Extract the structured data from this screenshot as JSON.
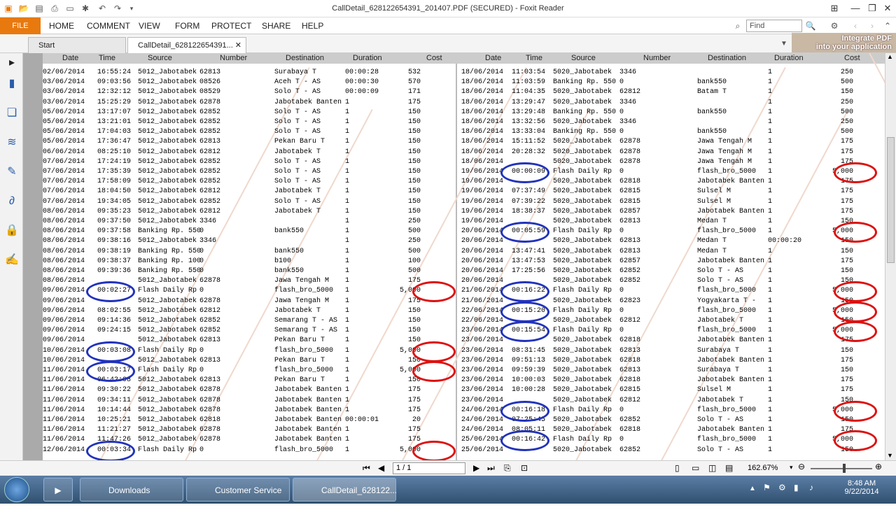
{
  "window": {
    "title": "CallDetail_628122654391_201407.PDF (SECURED) - Foxit Reader"
  },
  "ribbon": {
    "file": "FILE",
    "menus": [
      "HOME",
      "COMMENT",
      "VIEW",
      "FORM",
      "PROTECT",
      "SHARE",
      "HELP"
    ],
    "find_placeholder": "Find",
    "promo": [
      "Integrate PDF",
      "into your application"
    ]
  },
  "tabs": [
    "Start",
    "CallDetail_628122654391..."
  ],
  "table": {
    "headers": [
      "Date",
      "Time",
      "Source",
      "Number",
      "Destination",
      "Duration",
      "Cost"
    ],
    "left_rows": [
      [
        "02/06/2014",
        "16:55:24",
        "5012_Jabotabek",
        "62813",
        "Surabaya T",
        "00:00:28",
        "532"
      ],
      [
        "03/06/2014",
        "09:03:56",
        "5012_Jabotabek",
        "08526",
        "Aceh T - AS",
        "00:00:30",
        "570"
      ],
      [
        "03/06/2014",
        "12:32:12",
        "5012_Jabotabek",
        "08529",
        "Solo T - AS",
        "00:00:09",
        "171"
      ],
      [
        "03/06/2014",
        "15:25:29",
        "5012_Jabotabek",
        "62878",
        "Jabotabek Banten",
        "1",
        "175"
      ],
      [
        "05/06/2014",
        "13:17:07",
        "5012_Jabotabek",
        "62852",
        "Solo T - AS",
        "1",
        "150"
      ],
      [
        "05/06/2014",
        "13:21:01",
        "5012_Jabotabek",
        "62852",
        "Solo T - AS",
        "1",
        "150"
      ],
      [
        "05/06/2014",
        "17:04:03",
        "5012_Jabotabek",
        "62852",
        "Solo T - AS",
        "1",
        "150"
      ],
      [
        "05/06/2014",
        "17:36:47",
        "5012_Jabotabek",
        "62813",
        "Pekan Baru T",
        "1",
        "150"
      ],
      [
        "06/06/2014",
        "08:25:10",
        "5012_Jabotabek",
        "62812",
        "Jabotabek T",
        "1",
        "150"
      ],
      [
        "07/06/2014",
        "17:24:19",
        "5012_Jabotabek",
        "62852",
        "Solo T - AS",
        "1",
        "150"
      ],
      [
        "07/06/2014",
        "17:35:39",
        "5012_Jabotabek",
        "62852",
        "Solo T - AS",
        "1",
        "150"
      ],
      [
        "07/06/2014",
        "17:58:09",
        "5012_Jabotabek",
        "62852",
        "Solo T - AS",
        "1",
        "150"
      ],
      [
        "07/06/2014",
        "18:04:50",
        "5012_Jabotabek",
        "62812",
        "Jabotabek T",
        "1",
        "150"
      ],
      [
        "07/06/2014",
        "19:34:05",
        "5012_Jabotabek",
        "62852",
        "Solo T - AS",
        "1",
        "150"
      ],
      [
        "08/06/2014",
        "09:35:23",
        "5012_Jabotabek",
        "62812",
        "Jabotabek T",
        "1",
        "150"
      ],
      [
        "08/06/2014",
        "09:37:50",
        "5012_Jabotabek",
        "3346",
        "",
        "1",
        "250"
      ],
      [
        "08/06/2014",
        "09:37:58",
        "Banking Rp. 550",
        "0",
        "bank550",
        "1",
        "500"
      ],
      [
        "08/06/2014",
        "09:38:16",
        "5012_Jabotabek",
        "3346",
        "",
        "1",
        "250"
      ],
      [
        "08/06/2014",
        "09:38:19",
        "Banking Rp. 550",
        "0",
        "bank550",
        "1",
        "500"
      ],
      [
        "08/06/2014",
        "09:38:37",
        "Banking Rp. 100",
        "0",
        "b100",
        "1",
        "100"
      ],
      [
        "08/06/2014",
        "09:39:36",
        "Banking Rp. 550",
        "0",
        "bank550",
        "1",
        "500"
      ],
      [
        "08/06/2014",
        "",
        "5012_Jabotabek",
        "62878",
        "Jawa Tengah M",
        "1",
        "175"
      ],
      [
        "09/06/2014",
        "00:02:27",
        "Flash Daily Rp",
        "0",
        "flash_bro_5000",
        "1",
        "5,000"
      ],
      [
        "09/06/2014",
        "",
        "5012_Jabotabek",
        "62878",
        "Jawa Tengah M",
        "1",
        "175"
      ],
      [
        "09/06/2014",
        "08:02:55",
        "5012_Jabotabek",
        "62812",
        "Jabotabek T",
        "1",
        "150"
      ],
      [
        "09/06/2014",
        "09:14:36",
        "5012_Jabotabek",
        "62852",
        "Semarang T - AS",
        "1",
        "150"
      ],
      [
        "09/06/2014",
        "09:24:15",
        "5012_Jabotabek",
        "62852",
        "Semarang T - AS",
        "1",
        "150"
      ],
      [
        "09/06/2014",
        "",
        "5012_Jabotabek",
        "62813",
        "Pekan Baru T",
        "1",
        "150"
      ],
      [
        "10/06/2014",
        "00:03:08",
        "Flash Daily Rp",
        "0",
        "flash_bro_5000",
        "1",
        "5,000"
      ],
      [
        "10/06/2014",
        "",
        "5012_Jabotabek",
        "62813",
        "Pekan Baru T",
        "1",
        "150"
      ],
      [
        "11/06/2014",
        "00:03:17",
        "Flash Daily Rp",
        "0",
        "flash_bro_5000",
        "1",
        "5,000"
      ],
      [
        "11/06/2014",
        "06:42:08",
        "5012_Jabotabek",
        "62813",
        "Pekan Baru T",
        "1",
        "150"
      ],
      [
        "11/06/2014",
        "09:30:22",
        "5012_Jabotabek",
        "62878",
        "Jabotabek Banten",
        "1",
        "175"
      ],
      [
        "11/06/2014",
        "09:34:11",
        "5012_Jabotabek",
        "62878",
        "Jabotabek Banten",
        "1",
        "175"
      ],
      [
        "11/06/2014",
        "10:14:44",
        "5012_Jabotabek",
        "62878",
        "Jabotabek Banten",
        "1",
        "175"
      ],
      [
        "11/06/2014",
        "10:25:21",
        "5012_Jabotabek",
        "62818",
        "Jabotabek Banten",
        "00:00:01",
        "20"
      ],
      [
        "11/06/2014",
        "11:21:27",
        "5012_Jabotabek",
        "62878",
        "Jabotabek Banten",
        "1",
        "175"
      ],
      [
        "11/06/2014",
        "11:47:26",
        "5012_Jabotabek",
        "62878",
        "Jabotabek Banten",
        "1",
        "175"
      ],
      [
        "12/06/2014",
        "00:03:34",
        "Flash Daily Rp",
        "0",
        "flash_bro_5000",
        "1",
        "5,000"
      ]
    ],
    "right_rows": [
      [
        "18/06/2014",
        "11:03:54",
        "5020_Jabotabek",
        "3346",
        "",
        "1",
        "250"
      ],
      [
        "18/06/2014",
        "11:03:59",
        "Banking Rp. 550",
        "0",
        "bank550",
        "1",
        "500"
      ],
      [
        "18/06/2014",
        "11:04:35",
        "5020_Jabotabek",
        "62812",
        "Batam T",
        "1",
        "150"
      ],
      [
        "18/06/2014",
        "13:29:47",
        "5020_Jabotabek",
        "3346",
        "",
        "1",
        "250"
      ],
      [
        "18/06/2014",
        "13:29:48",
        "Banking Rp. 550",
        "0",
        "bank550",
        "1",
        "500"
      ],
      [
        "18/06/2014",
        "13:32:56",
        "5020_Jabotabek",
        "3346",
        "",
        "1",
        "250"
      ],
      [
        "18/06/2014",
        "13:33:04",
        "Banking Rp. 550",
        "0",
        "bank550",
        "1",
        "500"
      ],
      [
        "18/06/2014",
        "15:11:52",
        "5020_Jabotabek",
        "62878",
        "Jawa Tengah M",
        "1",
        "175"
      ],
      [
        "18/06/2014",
        "20:28:32",
        "5020_Jabotabek",
        "62878",
        "Jawa Tengah M",
        "1",
        "175"
      ],
      [
        "18/06/2014",
        "",
        "5020_Jabotabek",
        "62878",
        "Jawa Tengah M",
        "1",
        "175"
      ],
      [
        "19/06/2014",
        "00:00:09",
        "Flash Daily Rp",
        "0",
        "flash_bro_5000",
        "1",
        "5,000"
      ],
      [
        "19/06/2014",
        "",
        "5020_Jabotabek",
        "62818",
        "Jabotabek Banten",
        "1",
        "175"
      ],
      [
        "19/06/2014",
        "07:37:49",
        "5020_Jabotabek",
        "62815",
        "Sulsel M",
        "1",
        "175"
      ],
      [
        "19/06/2014",
        "07:39:22",
        "5020_Jabotabek",
        "62815",
        "Sulsel M",
        "1",
        "175"
      ],
      [
        "19/06/2014",
        "18:38:37",
        "5020_Jabotabek",
        "62857",
        "Jabotabek Banten",
        "1",
        "175"
      ],
      [
        "19/06/2014",
        "",
        "5020_Jabotabek",
        "62813",
        "Medan T",
        "1",
        "150"
      ],
      [
        "20/06/2014",
        "00:05:59",
        "Flash Daily Rp",
        "0",
        "flash_bro_5000",
        "1",
        "5,000"
      ],
      [
        "20/06/2014",
        "",
        "5020_Jabotabek",
        "62813",
        "Medan T",
        "00:00:20",
        "150"
      ],
      [
        "20/06/2014",
        "13:47:41",
        "5020_Jabotabek",
        "62813",
        "Medan T",
        "1",
        "150"
      ],
      [
        "20/06/2014",
        "13:47:53",
        "5020_Jabotabek",
        "62857",
        "Jabotabek Banten",
        "1",
        "175"
      ],
      [
        "20/06/2014",
        "17:25:56",
        "5020_Jabotabek",
        "62852",
        "Solo T - AS",
        "1",
        "150"
      ],
      [
        "20/06/2014",
        "",
        "5020_Jabotabek",
        "62852",
        "Solo T - AS",
        "1",
        "150"
      ],
      [
        "21/06/2014",
        "00:16:22",
        "Flash Daily Rp",
        "0",
        "flash_bro_5000",
        "1",
        "5,000"
      ],
      [
        "21/06/2014",
        "",
        "5020_Jabotabek",
        "62823",
        "Yogyakarta T -",
        "1",
        "150"
      ],
      [
        "22/06/2014",
        "00:15:20",
        "Flash Daily Rp",
        "0",
        "flash_bro_5000",
        "1",
        "5,000"
      ],
      [
        "22/06/2014",
        "",
        "5020_Jabotabek",
        "62812",
        "Jabotabek T",
        "1",
        "150"
      ],
      [
        "23/06/2014",
        "00:15:54",
        "Flash Daily Rp",
        "0",
        "flash_bro_5000",
        "1",
        "5,000"
      ],
      [
        "23/06/2014",
        "",
        "5020_Jabotabek",
        "62818",
        "Jabotabek Banten",
        "1",
        "175"
      ],
      [
        "23/06/2014",
        "08:31:45",
        "5020_Jabotabek",
        "62813",
        "Surabaya T",
        "1",
        "150"
      ],
      [
        "23/06/2014",
        "09:51:13",
        "5020_Jabotabek",
        "62818",
        "Jabotabek Banten",
        "1",
        "175"
      ],
      [
        "23/06/2014",
        "09:59:39",
        "5020_Jabotabek",
        "62813",
        "Surabaya T",
        "1",
        "150"
      ],
      [
        "23/06/2014",
        "10:00:03",
        "5020_Jabotabek",
        "62818",
        "Jabotabek Banten",
        "1",
        "175"
      ],
      [
        "23/06/2014",
        "10:00:28",
        "5020_Jabotabek",
        "62815",
        "Sulsel M",
        "1",
        "175"
      ],
      [
        "23/06/2014",
        "",
        "5020_Jabotabek",
        "62812",
        "Jabotabek T",
        "1",
        "150"
      ],
      [
        "24/06/2014",
        "00:16:18",
        "Flash Daily Rp",
        "0",
        "flash_bro_5000",
        "1",
        "5,000"
      ],
      [
        "24/06/2014",
        "07:25:45",
        "5020_Jabotabek",
        "62852",
        "Solo T - AS",
        "1",
        "150"
      ],
      [
        "24/06/2014",
        "08:05:11",
        "5020_Jabotabek",
        "62818",
        "Jabotabek Banten",
        "1",
        "175"
      ],
      [
        "25/06/2014",
        "00:16:42",
        "Flash Daily Rp",
        "0",
        "flash_bro_5000",
        "1",
        "5,000"
      ],
      [
        "25/06/2014",
        "",
        "5020_Jabotabek",
        "62852",
        "Solo T - AS",
        "1",
        "150"
      ]
    ]
  },
  "statusbar": {
    "page": "1 / 1",
    "zoom": "162.67%"
  },
  "taskbar": {
    "items": [
      "Downloads",
      "Customer Service ...",
      "CallDetail_628122..."
    ],
    "time": "8:48 AM",
    "date": "9/22/2014"
  },
  "annotations": {
    "circle_color": "#2233bb",
    "oval_color": "#dd1111"
  }
}
